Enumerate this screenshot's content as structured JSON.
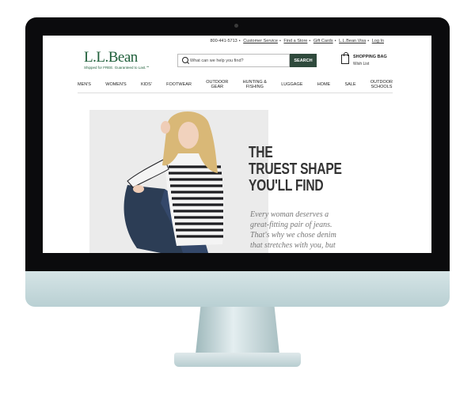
{
  "utility_bar": {
    "phone": "800-441-5713",
    "links": [
      "Customer Service",
      "Find a Store",
      "Gift Cards",
      "L.L.Bean Visa",
      "Log In"
    ]
  },
  "logo": {
    "text": "L.L.Bean",
    "tagline": "Shipped for FREE. Guaranteed to Last.℠"
  },
  "search": {
    "placeholder": "What can we help you find?",
    "button": "SEARCH"
  },
  "bag": {
    "title": "SHOPPING BAG",
    "wish_list": "Wish List"
  },
  "nav": {
    "items": [
      {
        "line1": "MEN'S",
        "line2": ""
      },
      {
        "line1": "WOMEN'S",
        "line2": ""
      },
      {
        "line1": "KIDS'",
        "line2": ""
      },
      {
        "line1": "FOOTWEAR",
        "line2": ""
      },
      {
        "line1": "OUTDOOR",
        "line2": "GEAR"
      },
      {
        "line1": "HUNTING &",
        "line2": "FISHING"
      },
      {
        "line1": "LUGGAGE",
        "line2": ""
      },
      {
        "line1": "HOME",
        "line2": ""
      },
      {
        "line1": "SALE",
        "line2": ""
      },
      {
        "line1": "OUTDOOR",
        "line2": "SCHOOLS"
      }
    ]
  },
  "hero": {
    "title": [
      "THE",
      "TRUEST SHAPE",
      "YOU'LL FIND"
    ],
    "body": [
      "Every woman deserves a",
      "great-fitting pair of jeans.",
      "That's why we chose denim",
      "that stretches with you, but"
    ]
  },
  "colors": {
    "brand_green": "#1f5f3a",
    "search_button": "#2f4a3c"
  }
}
